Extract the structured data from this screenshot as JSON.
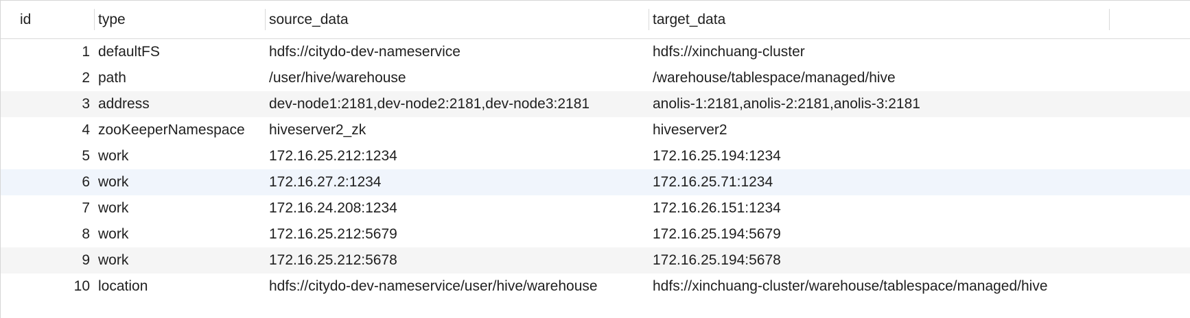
{
  "table": {
    "columns": [
      {
        "key": "id",
        "label": "id"
      },
      {
        "key": "type",
        "label": "type"
      },
      {
        "key": "source_data",
        "label": "source_data"
      },
      {
        "key": "target_data",
        "label": "target_data"
      }
    ],
    "rows": [
      {
        "id": "1",
        "type": "defaultFS",
        "source_data": "hdfs://citydo-dev-nameservice",
        "target_data": "hdfs://xinchuang-cluster"
      },
      {
        "id": "2",
        "type": "path",
        "source_data": "/user/hive/warehouse",
        "target_data": "/warehouse/tablespace/managed/hive"
      },
      {
        "id": "3",
        "type": "address",
        "source_data": "dev-node1:2181,dev-node2:2181,dev-node3:2181",
        "target_data": "anolis-1:2181,anolis-2:2181,anolis-3:2181"
      },
      {
        "id": "4",
        "type": "zooKeeperNamespace",
        "source_data": "hiveserver2_zk",
        "target_data": "hiveserver2"
      },
      {
        "id": "5",
        "type": "work",
        "source_data": "172.16.25.212:1234",
        "target_data": "172.16.25.194:1234"
      },
      {
        "id": "6",
        "type": "work",
        "source_data": "172.16.27.2:1234",
        "target_data": "172.16.25.71:1234"
      },
      {
        "id": "7",
        "type": "work",
        "source_data": "172.16.24.208:1234",
        "target_data": "172.16.26.151:1234"
      },
      {
        "id": "8",
        "type": "work",
        "source_data": "172.16.25.212:5679",
        "target_data": "172.16.25.194:5679"
      },
      {
        "id": "9",
        "type": "work",
        "source_data": "172.16.25.212:5678",
        "target_data": "172.16.25.194:5678"
      },
      {
        "id": "10",
        "type": "location",
        "source_data": "hdfs://citydo-dev-nameservice/user/hive/warehouse",
        "target_data": "hdfs://xinchuang-cluster/warehouse/tablespace/managed/hive"
      }
    ]
  }
}
